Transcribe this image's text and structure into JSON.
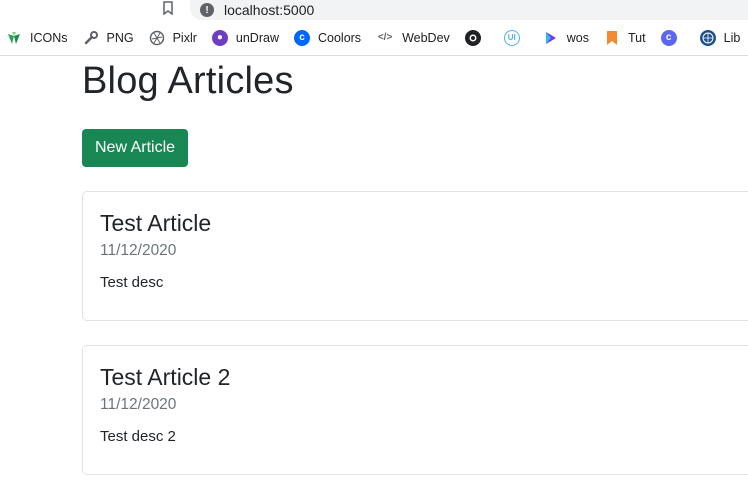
{
  "browser": {
    "url": "localhost:5000",
    "bookmarks": [
      {
        "label": "ICONs",
        "icon": "icons8-icon",
        "color": "#26a65b"
      },
      {
        "label": "PNG",
        "icon": "wrench-icon",
        "color": "#5f6368"
      },
      {
        "label": "Pixlr",
        "icon": "aperture-icon",
        "color": "#5f6368"
      },
      {
        "label": "unDraw",
        "icon": "undraw-icon",
        "color": "#6c3ec1"
      },
      {
        "label": "Coolors",
        "icon": "coolors-icon",
        "color": "#0066ff"
      },
      {
        "label": "WebDev",
        "icon": "code-icon",
        "color": "#5f6368"
      },
      {
        "label": "",
        "icon": "github-icon",
        "color": "#202124"
      },
      {
        "label": "",
        "icon": "ui-icon",
        "color": "#4fb3e8"
      },
      {
        "label": "wos",
        "icon": "wos-icon",
        "color": "#7b2ff7"
      },
      {
        "label": "Tut",
        "icon": "bookmark-ribbon-icon",
        "color": "#f28b30"
      },
      {
        "label": "",
        "icon": "c-icon",
        "color": "#5b67f1"
      },
      {
        "label": "Lib",
        "icon": "globe-icon",
        "color": "#1f4e8c"
      },
      {
        "label": "",
        "icon": "infinity-icon",
        "color": "#1a73e8"
      }
    ]
  },
  "page": {
    "title": "Blog Articles",
    "new_button_label": "New Article",
    "articles": [
      {
        "title": "Test Article",
        "date": "11/12/2020",
        "description": "Test desc"
      },
      {
        "title": "Test Article 2",
        "date": "11/12/2020",
        "description": "Test desc 2"
      }
    ]
  },
  "colors": {
    "button_bg": "#198754",
    "date_text": "#6c757d"
  }
}
